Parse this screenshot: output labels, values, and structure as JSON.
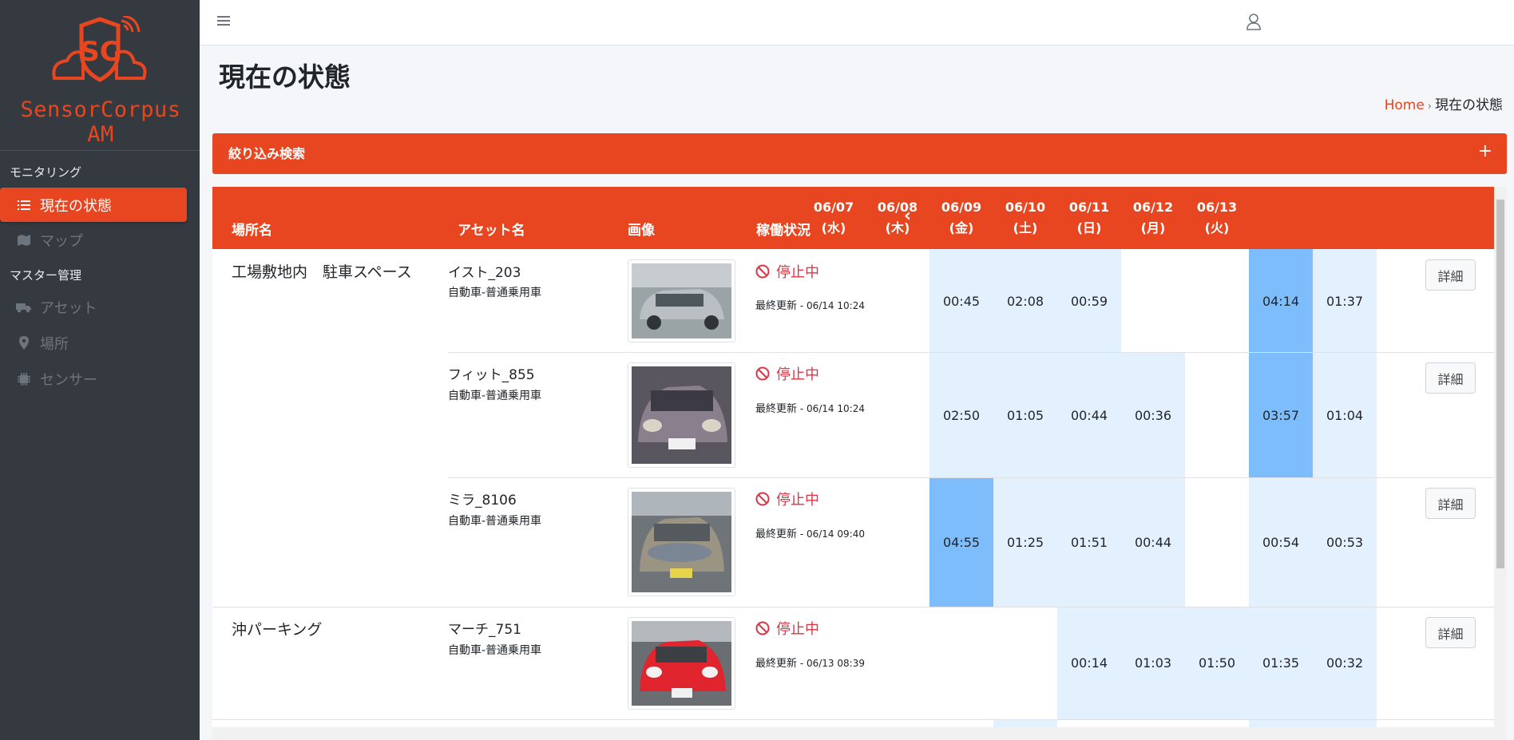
{
  "brand": {
    "name": "SensorCorpus AM",
    "logo_text": "SC",
    "accent": "#e84620"
  },
  "sidebar": {
    "section1": "モニタリング",
    "section2": "マスター管理",
    "items": [
      {
        "label": "現在の状態",
        "icon": "list-icon"
      },
      {
        "label": "マップ",
        "icon": "map-icon"
      },
      {
        "label": "アセット",
        "icon": "truck-icon"
      },
      {
        "label": "場所",
        "icon": "map-marker-icon"
      },
      {
        "label": "センサー",
        "icon": "chip-icon"
      }
    ]
  },
  "header": {
    "menu_icon": "hamburger-icon",
    "user_icon": "user-icon"
  },
  "page": {
    "title": "現在の状態",
    "breadcrumb_home": "Home",
    "breadcrumb_sep": "›",
    "breadcrumb_current": "現在の状態"
  },
  "filter": {
    "title": "絞り込み検索",
    "toggle": "+"
  },
  "table": {
    "col_place": "場所名",
    "col_asset": "アセット名",
    "col_image": "画像",
    "col_status": "稼働状況",
    "prev": "‹",
    "dates": [
      {
        "d": "06/07",
        "w": "(水)"
      },
      {
        "d": "06/08",
        "w": "(木)"
      },
      {
        "d": "06/09",
        "w": "(金)"
      },
      {
        "d": "06/10",
        "w": "(土)"
      },
      {
        "d": "06/11",
        "w": "(日)"
      },
      {
        "d": "06/12",
        "w": "(月)"
      },
      {
        "d": "06/13",
        "w": "(火)"
      }
    ],
    "detail_label": "詳細",
    "updated_label": "最終更新",
    "rows": [
      {
        "place": "工場敷地内　駐車スペース",
        "asset": "イスト_203",
        "type": "自動車-普通乗用車",
        "status": "停止中",
        "updated": "06/14 10:24",
        "hours": [
          "00:45",
          "02:08",
          "00:59",
          "",
          "",
          "04:14",
          "01:37"
        ]
      },
      {
        "place": "",
        "asset": "フィット_855",
        "type": "自動車-普通乗用車",
        "status": "停止中",
        "updated": "06/14 10:24",
        "hours": [
          "02:50",
          "01:05",
          "00:44",
          "00:36",
          "",
          "03:57",
          "01:04"
        ]
      },
      {
        "place": "",
        "asset": "ミラ_8106",
        "type": "自動車-普通乗用車",
        "status": "停止中",
        "updated": "06/14 09:40",
        "hours": [
          "04:55",
          "01:25",
          "01:51",
          "00:44",
          "",
          "00:54",
          "00:53"
        ]
      },
      {
        "place": "沖パーキング",
        "asset": "マーチ_751",
        "type": "自動車-普通乗用車",
        "status": "停止中",
        "updated": "06/13 08:39",
        "hours": [
          "",
          "",
          "00:14",
          "01:03",
          "01:50",
          "01:35",
          "00:32"
        ]
      }
    ]
  }
}
